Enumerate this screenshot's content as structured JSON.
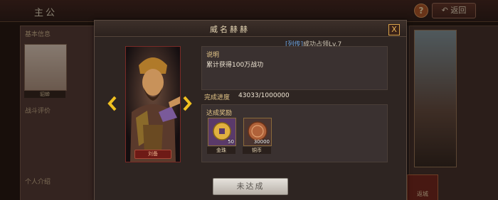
{
  "background": {
    "title": "主公",
    "help_label": "?",
    "back_label": "返回",
    "left_panel": {
      "section_title": "基本信息",
      "portrait_caption": "貂蝉",
      "rating_label": "战斗评价",
      "profile_label": "个人介绍"
    },
    "right_panel": {
      "button_label": "返城"
    }
  },
  "dialog": {
    "title": "威名赫赫",
    "close_label": "X",
    "ticker": {
      "tag": "[列传]",
      "text": "成功占领Lv.7"
    },
    "hero": {
      "banner": "刘备"
    },
    "description": {
      "label": "说明",
      "text": "累计获得100万战功"
    },
    "progress": {
      "label": "完成进度",
      "current": 43033,
      "target": 1000000,
      "text": "43033/1000000"
    },
    "rewards": {
      "label": "达成奖励",
      "items": [
        {
          "name": "金珠",
          "count": "50",
          "icon": "gold-coin-icon"
        },
        {
          "name": "铜币",
          "count": "30000",
          "icon": "copper-coin-icon"
        }
      ]
    },
    "status_button": "未达成"
  },
  "colors": {
    "accent_gold": "#e7c88a",
    "arrow_yellow": "#f0c020",
    "ticker_blue": "#6aa2e0",
    "panel": "#3a3130"
  }
}
